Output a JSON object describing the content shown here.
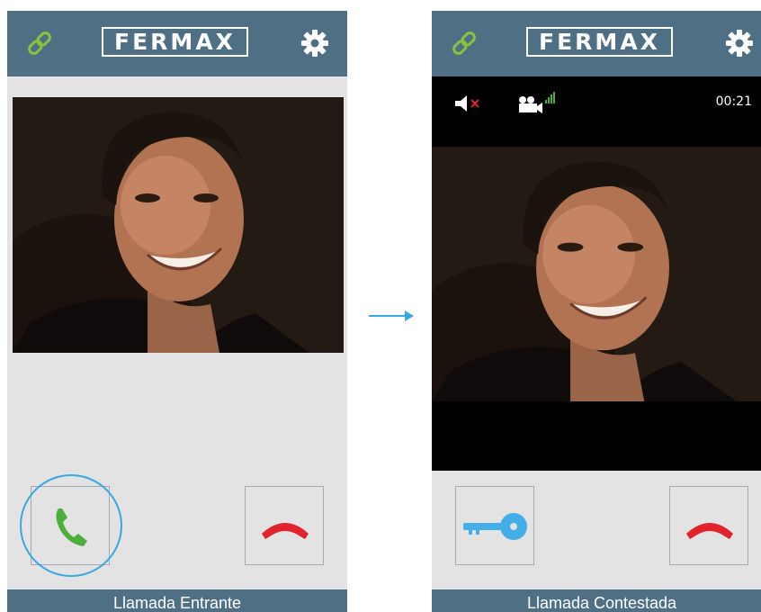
{
  "brand": {
    "logo_text": "FERMAX",
    "bar_color": "#4f6f85"
  },
  "left_screen": {
    "status_text": "Llamada Entrante",
    "answer_button_color": "#4caf3c",
    "hangup_button_color": "#e0232d",
    "highlight_color": "#36a9e0"
  },
  "right_screen": {
    "status_text": "Llamada Contestada",
    "call_timer": "00:21",
    "key_button_color": "#44aee8",
    "hangup_button_color": "#e0232d"
  },
  "icons": {
    "link": "link-icon",
    "settings": "gear-icon",
    "answer": "phone-answer-icon",
    "hangup": "phone-hangup-icon",
    "unlock": "key-icon",
    "mute": "speaker-muted-icon",
    "camera": "camera-signal-icon"
  }
}
